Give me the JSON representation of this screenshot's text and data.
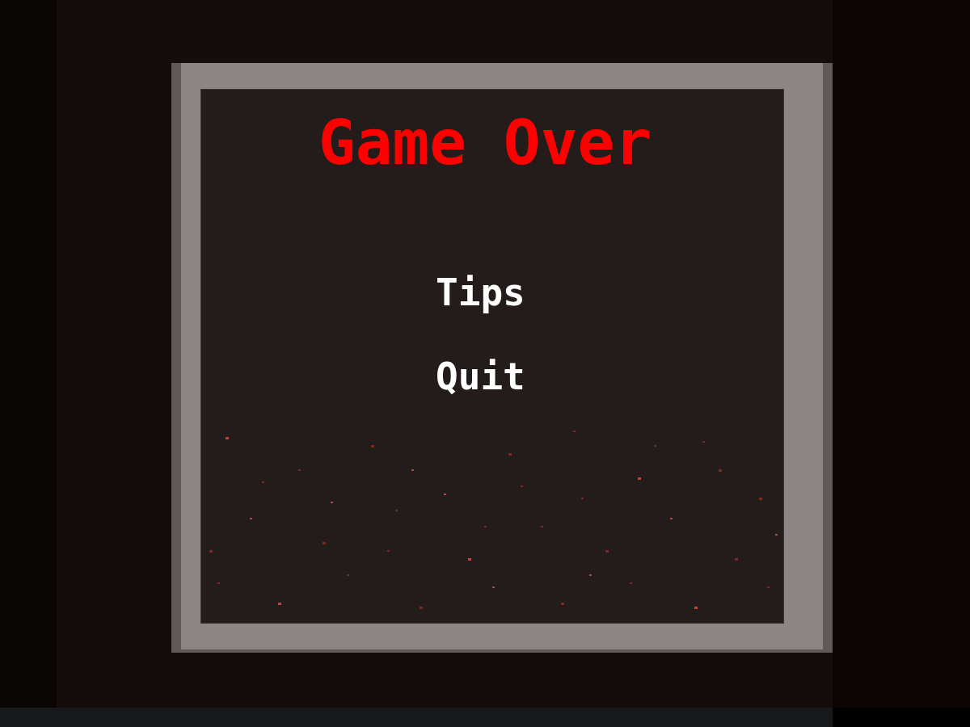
{
  "dialog": {
    "title": "Game Over",
    "menu": [
      {
        "label": "Tips"
      },
      {
        "label": "Quit"
      }
    ]
  }
}
